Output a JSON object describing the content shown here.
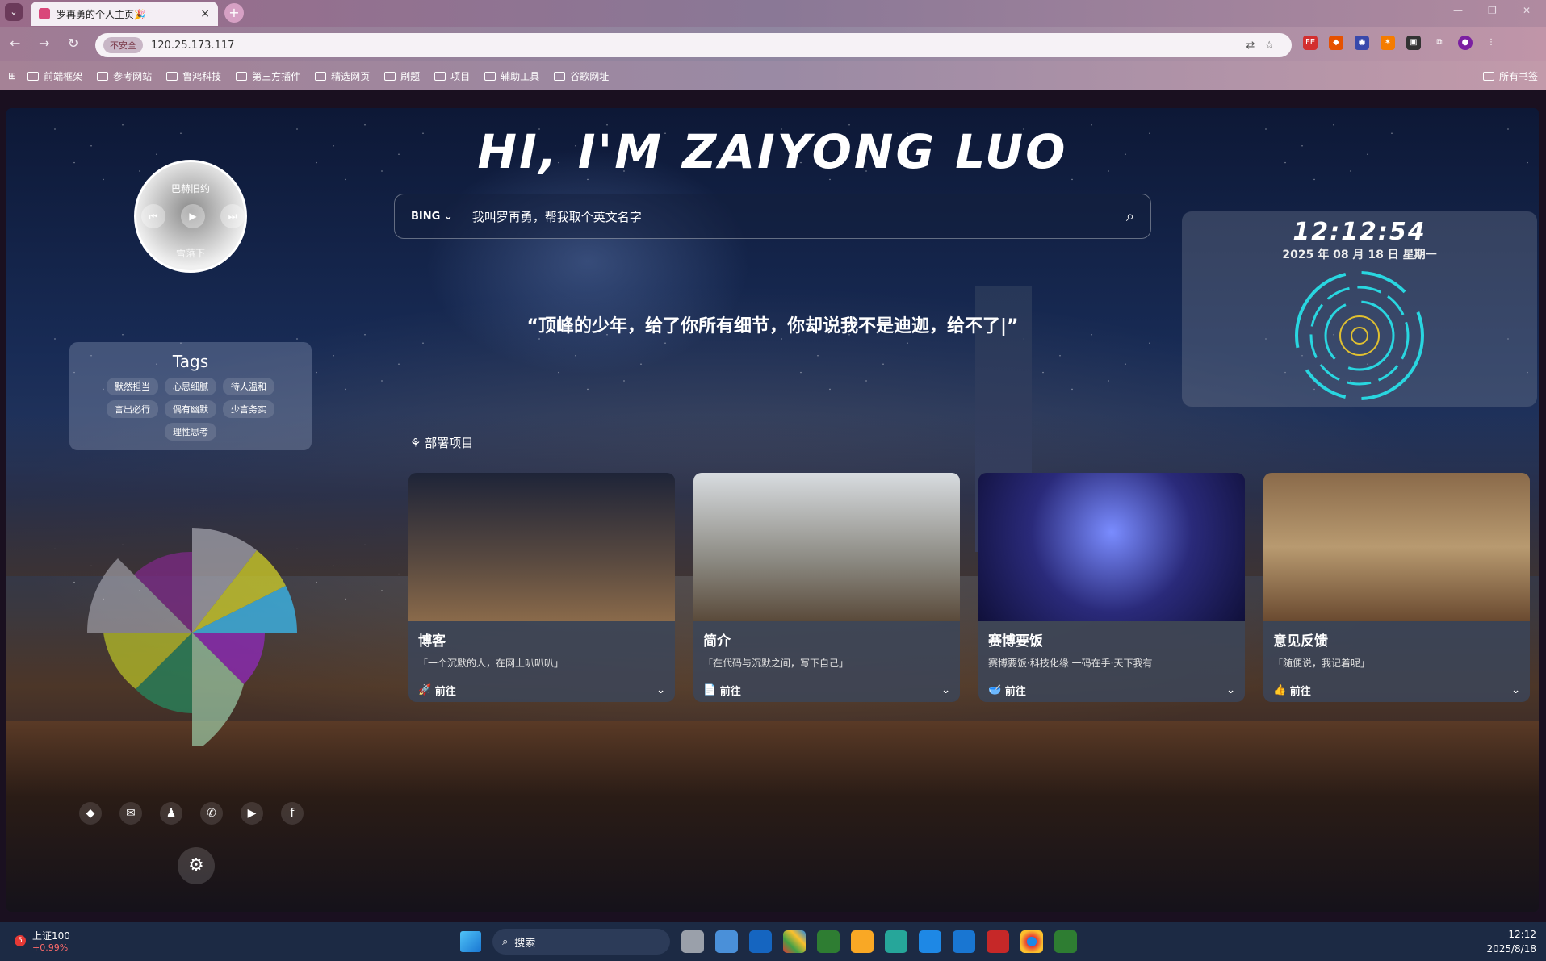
{
  "browser": {
    "tab_title": "罗再勇的个人主页🎉",
    "tab_close": "×",
    "new_tab": "+",
    "address_insecure": "不安全",
    "address": "120.25.173.117",
    "bookmarks": [
      "前端框架",
      "参考网站",
      "鲁鸿科技",
      "第三方插件",
      "精选网页",
      "刷题",
      "项目",
      "辅助工具",
      "谷歌网址"
    ],
    "bookmarks_all": "所有书签"
  },
  "page": {
    "headline": "HI, I'M ZAIYONG LUO",
    "search": {
      "engine": "BING",
      "text": "我叫罗再勇，帮我取个英文名字"
    },
    "quote": "“顶峰的少年，给了你所有细节，你却说我不是迪迦，给不了|”",
    "music": {
      "song": "巴赫旧约",
      "artist": "雪落下"
    },
    "tags": {
      "title": "Tags",
      "items": [
        "默然担当",
        "心思细腻",
        "待人温和",
        "言出必行",
        "偶有幽默",
        "少言务实",
        "理性思考"
      ]
    },
    "clock": {
      "time": "12:12:54",
      "date": "2025 年 08 月 18 日 星期一"
    },
    "projects_label": "部署项目",
    "cards": [
      {
        "title": "博客",
        "desc": "「一个沉默的人，在网上叭叭叭」",
        "action": "前往"
      },
      {
        "title": "简介",
        "desc": "「在代码与沉默之间，写下自己」",
        "action": "前往"
      },
      {
        "title": "赛博要饭",
        "desc": "赛博要饭·科技化缘 一码在手·天下我有",
        "action": "前往"
      },
      {
        "title": "意见反馈",
        "desc": "「随便说，我记着呢」",
        "action": "前往"
      }
    ],
    "socials": [
      "git-icon",
      "mail-icon",
      "qq-icon",
      "wechat-icon",
      "youtube-icon",
      "facebook-icon"
    ]
  },
  "taskbar": {
    "stock_name": "上证100",
    "stock_change": "+0.99%",
    "badge": "5",
    "search": "搜索",
    "time": "12:12",
    "date": "2025/8/18"
  }
}
